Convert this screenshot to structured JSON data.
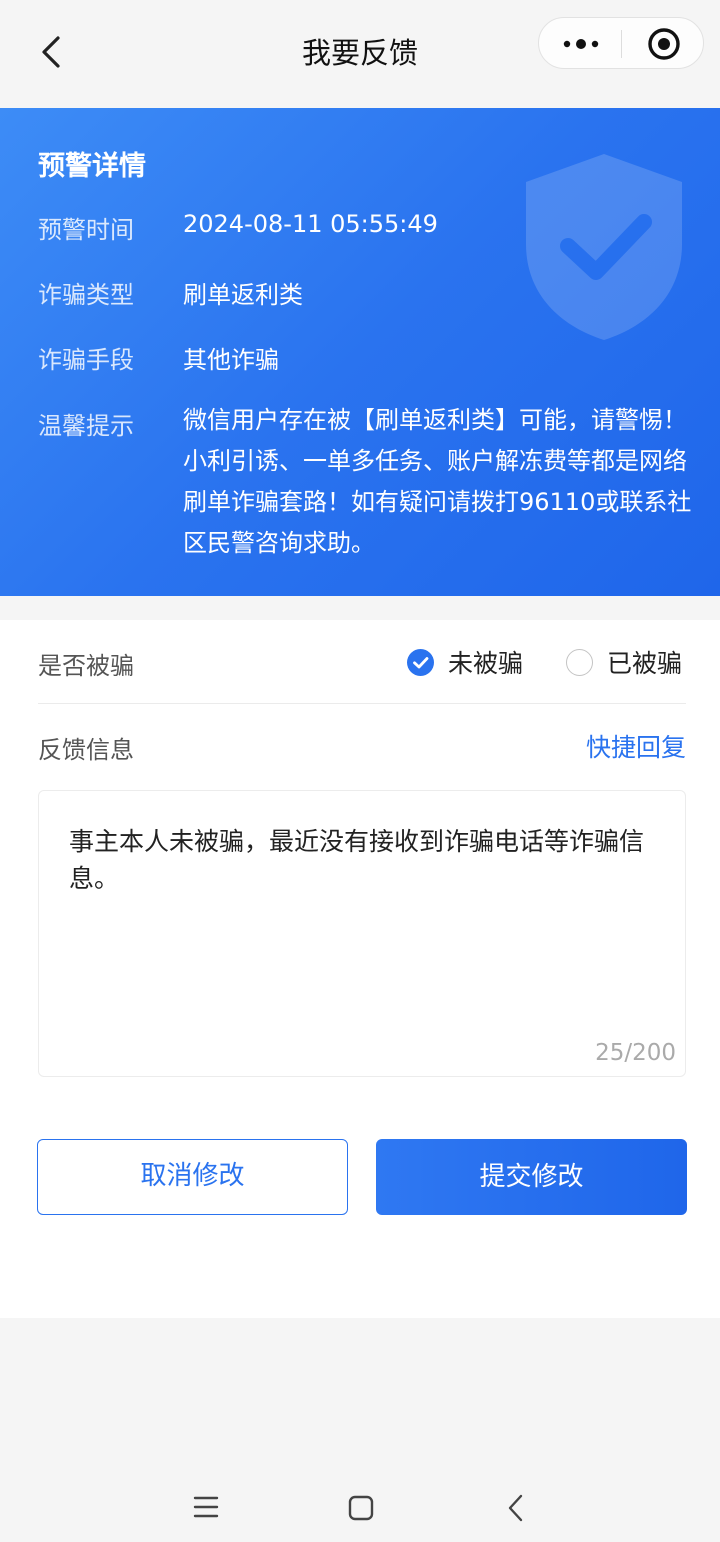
{
  "nav": {
    "title": "我要反馈",
    "back_icon": "chevron-left-icon",
    "more_icon": "more-dots-icon",
    "close_icon": "target-circle-icon"
  },
  "alert": {
    "title": "预警详情",
    "rows": [
      {
        "label": "预警时间",
        "value": "2024-08-11 05:55:49"
      },
      {
        "label": "诈骗类型",
        "value": "刷单返利类"
      },
      {
        "label": "诈骗手段",
        "value": "其他诈骗"
      },
      {
        "label": "温馨提示",
        "value": "微信用户存在被【刷单返利类】可能，请警惕！小利引诱、一单多任务、账户解冻费等都是网络刷单诈骗套路！如有疑问请拨打96110或联系社区民警咨询求助。"
      }
    ],
    "background_icon": "shield-check-icon"
  },
  "form": {
    "deceived_label": "是否被骗",
    "options": [
      {
        "label": "未被骗",
        "checked": true
      },
      {
        "label": "已被骗",
        "checked": false
      }
    ],
    "feedback_label": "反馈信息",
    "quick_reply": "快捷回复",
    "feedback_text": "事主本人未被骗，最近没有接收到诈骗电话等诈骗信息。",
    "char_count": "25/200",
    "cancel_label": "取消修改",
    "submit_label": "提交修改"
  },
  "system_bar": {
    "icons": [
      "menu-icon",
      "home-square-icon",
      "back-arrow-icon"
    ]
  },
  "colors": {
    "accent": "#2a73ef",
    "card_bg": "#2a73ef",
    "page_bg": "#f5f5f5"
  }
}
